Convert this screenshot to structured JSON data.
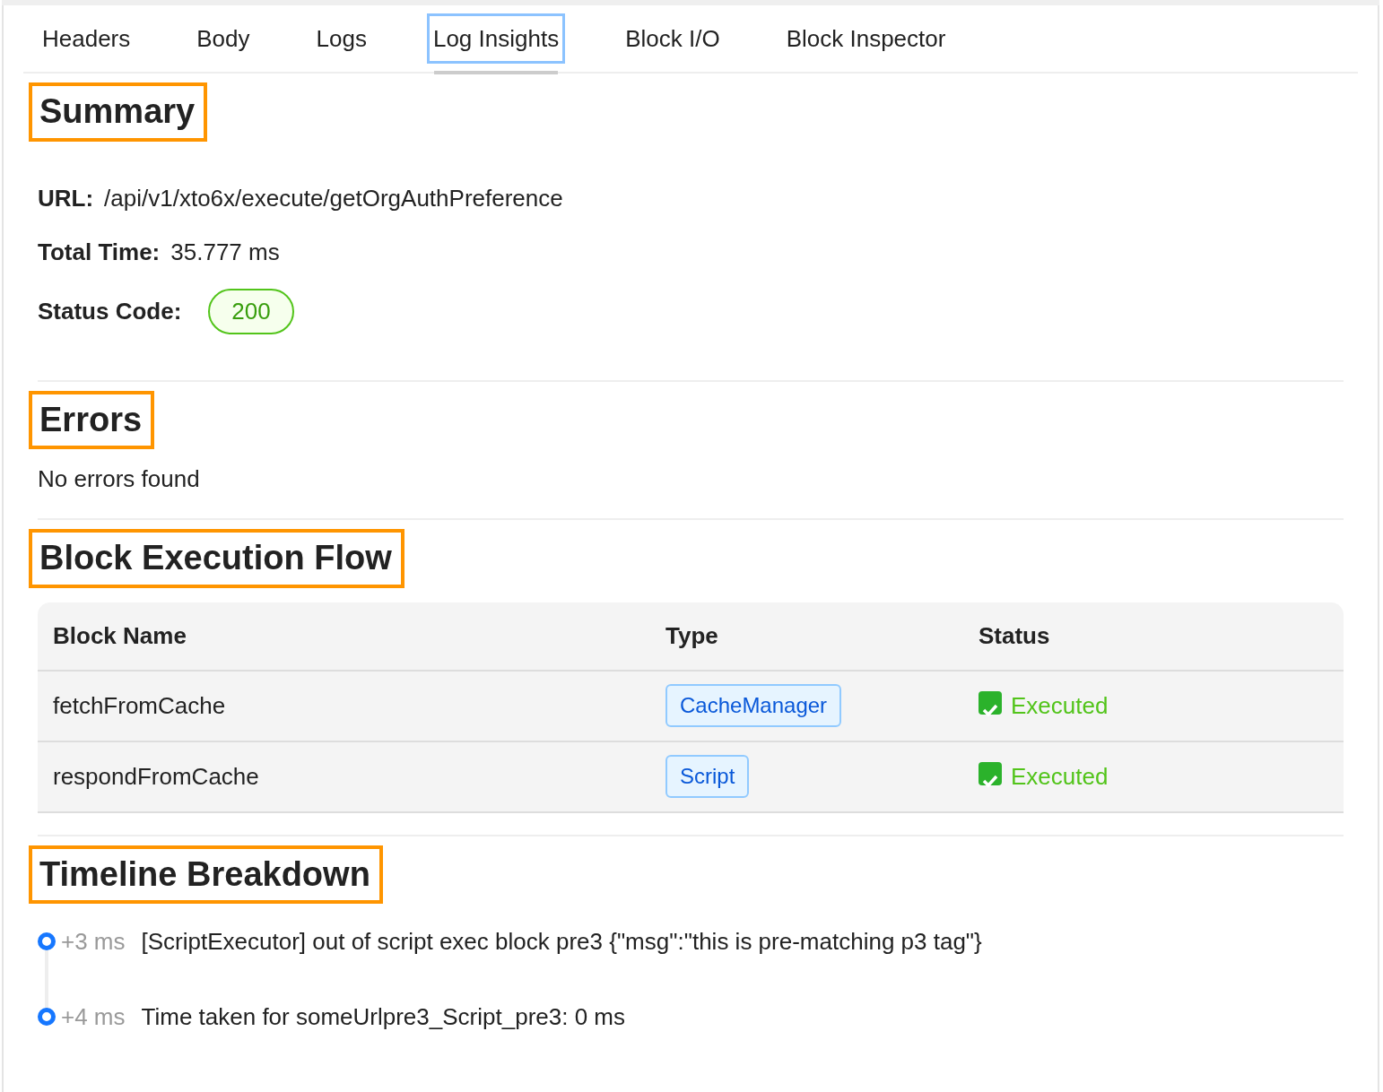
{
  "tabs": [
    {
      "label": "Headers",
      "selected": false
    },
    {
      "label": "Body",
      "selected": false
    },
    {
      "label": "Logs",
      "selected": false
    },
    {
      "label": "Log Insights",
      "selected": true
    },
    {
      "label": "Block I/O",
      "selected": false
    },
    {
      "label": "Block Inspector",
      "selected": false
    }
  ],
  "summary": {
    "title": "Summary",
    "fields": [
      {
        "label": "URL:",
        "value": "/api/v1/xto6x/execute/getOrgAuthPreference",
        "kind": "text"
      },
      {
        "label": "Total Time:",
        "value": "35.777 ms",
        "kind": "text"
      },
      {
        "label": "Status Code:",
        "value": "200",
        "kind": "pill"
      }
    ]
  },
  "errors": {
    "title": "Errors",
    "message": "No errors found"
  },
  "flow": {
    "title": "Block Execution Flow",
    "columns": [
      "Block Name",
      "Type",
      "Status"
    ],
    "rows": [
      {
        "name": "fetchFromCache",
        "type": "CacheManager",
        "status": "Executed",
        "ok": true
      },
      {
        "name": "respondFromCache",
        "type": "Script",
        "status": "Executed",
        "ok": true
      }
    ]
  },
  "timeline": {
    "title": "Timeline Breakdown",
    "entries": [
      {
        "offset": "+3 ms",
        "text": "[ScriptExecutor] out of script exec block pre3 {\"msg\":\"this is pre-matching p3 tag\"}"
      },
      {
        "offset": "+4 ms",
        "text": "Time taken for someUrlpre3_Script_pre3: 0 ms"
      }
    ]
  }
}
